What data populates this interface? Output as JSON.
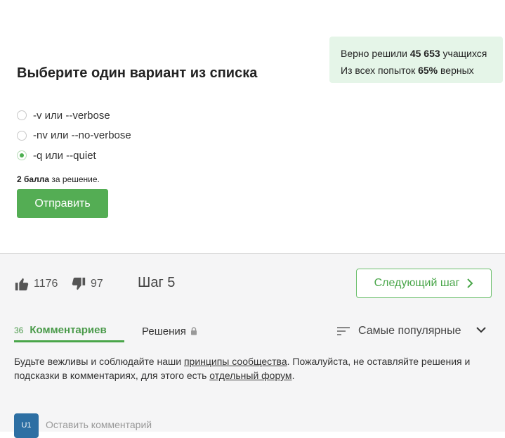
{
  "stats": {
    "solved_prefix": "Верно решили",
    "solved_count": "45 653",
    "solved_suffix": "учащихся",
    "attempts_prefix": "Из всех попыток",
    "attempts_percent": "65%",
    "attempts_suffix": "верных"
  },
  "question": {
    "title": "Выберите один вариант из списка",
    "options": [
      {
        "label": "-v или --verbose",
        "selected": false
      },
      {
        "label": "-nv или --no-verbose",
        "selected": false
      },
      {
        "label": "-q или --quiet",
        "selected": true
      }
    ],
    "points_bold": "2 балла",
    "points_rest": "за решение.",
    "submit_label": "Отправить"
  },
  "footer": {
    "likes": "1176",
    "dislikes": "97",
    "step_title": "Шаг 5",
    "next_step_label": "Следующий шаг"
  },
  "tabs": {
    "comments_count": "36",
    "comments_label": "Комментариев",
    "solutions_label": "Решения",
    "sort_label": "Самые популярные"
  },
  "notice": {
    "part1": "Будьте вежливы и соблюдайте наши",
    "link1": "принципы сообщества",
    "part2": ". Пожалуйста, не оставляйте решения и подсказки в комментариях, для этого есть",
    "link2": "отдельный форум",
    "part3": "."
  },
  "comment": {
    "avatar_text": "U1",
    "placeholder": "Оставить комментарий"
  },
  "colors": {
    "accent": "#54ad54",
    "stats_bg": "#e5f5e8",
    "avatar_bg": "#2d6fa3"
  }
}
